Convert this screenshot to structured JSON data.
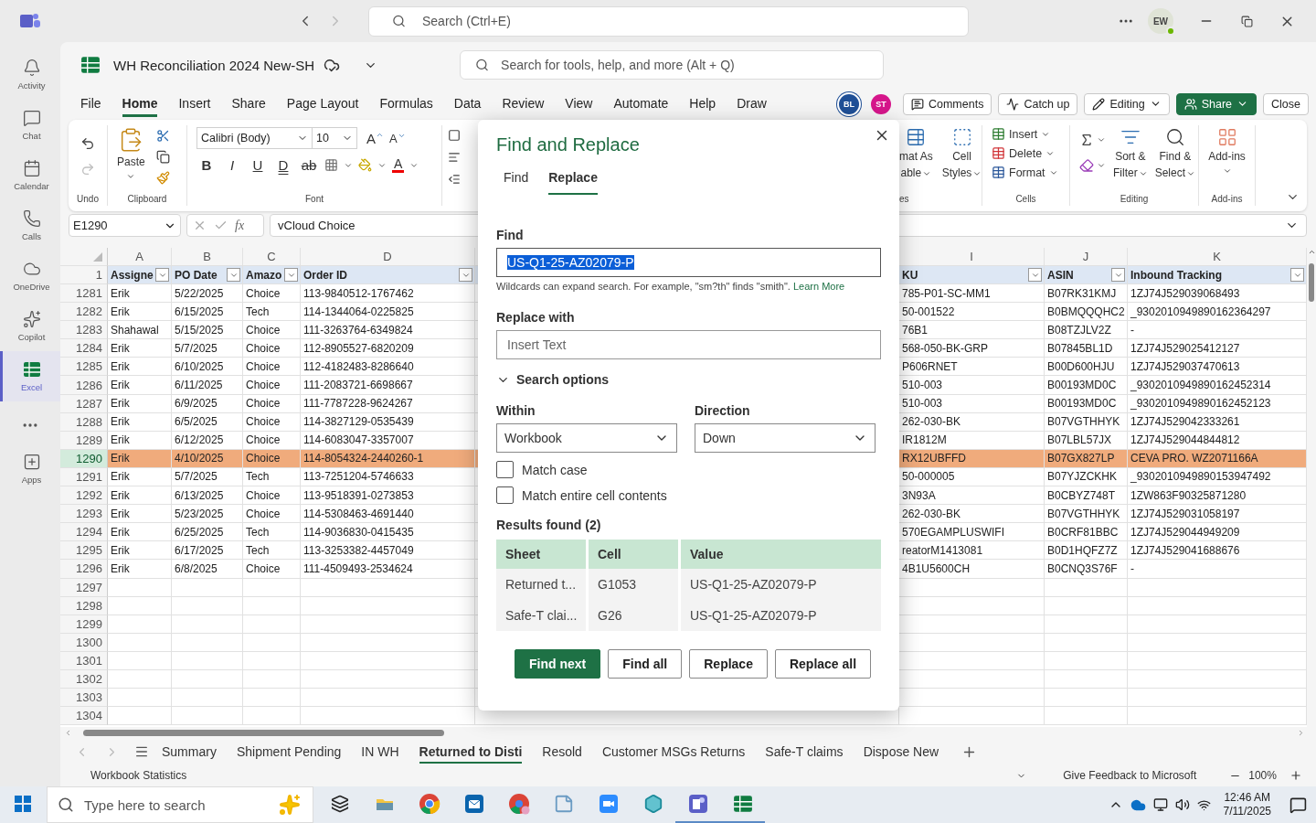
{
  "teams_bar": {
    "search_placeholder": "Search (Ctrl+E)",
    "avatar": "EW"
  },
  "rail": {
    "items": [
      {
        "label": "Activity",
        "selected": false
      },
      {
        "label": "Chat",
        "selected": false
      },
      {
        "label": "Calendar",
        "selected": false
      },
      {
        "label": "Calls",
        "selected": false
      },
      {
        "label": "OneDrive",
        "selected": false
      },
      {
        "label": "Copilot",
        "selected": false
      },
      {
        "label": "Excel",
        "selected": true
      }
    ],
    "apps_label": "Apps"
  },
  "workbook": {
    "title": "WH Reconciliation 2024 New-SH",
    "search_placeholder": "Search for tools, help, and more (Alt + Q)"
  },
  "menu_tabs": [
    {
      "label": "File",
      "selected": false
    },
    {
      "label": "Home",
      "selected": true
    },
    {
      "label": "Insert",
      "selected": false
    },
    {
      "label": "Share",
      "selected": false
    },
    {
      "label": "Page Layout",
      "selected": false
    },
    {
      "label": "Formulas",
      "selected": false
    },
    {
      "label": "Data",
      "selected": false
    },
    {
      "label": "Review",
      "selected": false
    },
    {
      "label": "View",
      "selected": false
    },
    {
      "label": "Automate",
      "selected": false
    },
    {
      "label": "Help",
      "selected": false
    },
    {
      "label": "Draw",
      "selected": false
    }
  ],
  "collaborators": [
    {
      "initials": "BL",
      "color": "#1f4f96"
    },
    {
      "initials": "ST",
      "color": "#d6168b"
    }
  ],
  "actions": [
    {
      "label": "Comments",
      "kind": "plain",
      "caret": false
    },
    {
      "label": "Catch up",
      "kind": "plain",
      "caret": false
    },
    {
      "label": "Editing",
      "kind": "plain",
      "caret": true
    },
    {
      "label": "Share",
      "kind": "primary",
      "caret": true
    },
    {
      "label": "Close",
      "kind": "plain",
      "caret": false
    }
  ],
  "ribbon": {
    "undo": {
      "label": "Undo",
      "redo_disabled": true
    },
    "clipboard": {
      "label": "Clipboard",
      "paste": "Paste"
    },
    "font": {
      "label": "Font",
      "face": "Calibri (Body)",
      "size": "10",
      "grow": "A",
      "shrink": "A",
      "font_color": "A",
      "styles": [
        {
          "label": "B",
          "kind": "bold"
        },
        {
          "label": "I",
          "kind": "italic"
        },
        {
          "label": "U",
          "kind": "underline"
        },
        {
          "label": "D",
          "kind": "double"
        },
        {
          "label": "ab",
          "kind": "strike"
        }
      ]
    },
    "styles_group": {
      "label": "es",
      "format_table": [
        "mat As",
        "able"
      ],
      "cell_styles": [
        "Cell",
        "Styles"
      ]
    },
    "cells": {
      "label": "Cells",
      "items": [
        "Insert",
        "Delete",
        "Format"
      ]
    },
    "editing": {
      "label": "Editing",
      "sort": [
        "Sort &",
        "Filter"
      ],
      "find": [
        "Find &",
        "Select"
      ]
    },
    "addins": {
      "label": "Add-ins",
      "button": "Add-ins"
    }
  },
  "formula_bar": {
    "name_box": "E1290",
    "fx": "fx",
    "value": "vCloud Choice"
  },
  "grid": {
    "header_row_number": "1",
    "columns": [
      {
        "letter": "A",
        "header": "Assigne"
      },
      {
        "letter": "B",
        "header": "PO Date"
      },
      {
        "letter": "C",
        "header": "Amazo"
      },
      {
        "letter": "D",
        "header": "Order ID"
      },
      {
        "letter": "I",
        "header": "KU"
      },
      {
        "letter": "J",
        "header": "ASIN"
      },
      {
        "letter": "K",
        "header": "Inbound Tracking"
      }
    ],
    "rows": [
      {
        "number": "1281",
        "selected": false,
        "cells": [
          "Erik",
          "5/22/2025",
          "Choice",
          "113-9840512-1767462",
          "785-P01-SC-MM1",
          "B07RK31KMJ",
          "1ZJ74J529039068493"
        ]
      },
      {
        "number": "1282",
        "selected": false,
        "cells": [
          "Erik",
          "6/15/2025",
          "Tech",
          "114-1344064-0225825",
          "50-001522",
          "B0BMQQQHC2",
          "_9302010949890162364297"
        ]
      },
      {
        "number": "1283",
        "selected": false,
        "cells": [
          "Shahawal",
          "5/15/2025",
          "Choice",
          "111-3263764-6349824",
          "76B1",
          "B08TZJLV2Z",
          "-"
        ]
      },
      {
        "number": "1284",
        "selected": false,
        "cells": [
          "Erik",
          "5/7/2025",
          "Choice",
          "112-8905527-6820209",
          "568-050-BK-GRP",
          "B07845BL1D",
          "1ZJ74J529025412127"
        ]
      },
      {
        "number": "1285",
        "selected": false,
        "cells": [
          "Erik",
          "6/10/2025",
          "Choice",
          "112-4182483-8286640",
          "P606RNET",
          "B00D600HJU",
          "1ZJ74J529037470613"
        ]
      },
      {
        "number": "1286",
        "selected": false,
        "cells": [
          "Erik",
          "6/11/2025",
          "Choice",
          "111-2083721-6698667",
          "510-003",
          "B00193MD0C",
          "_9302010949890162452314"
        ]
      },
      {
        "number": "1287",
        "selected": false,
        "cells": [
          "Erik",
          "6/9/2025",
          "Choice",
          "111-7787228-9624267",
          "510-003",
          "B00193MD0C",
          "_9302010949890162452123"
        ]
      },
      {
        "number": "1288",
        "selected": false,
        "cells": [
          "Erik",
          "6/5/2025",
          "Choice",
          "114-3827129-0535439",
          "262-030-BK",
          "B07VGTHHYK",
          "1ZJ74J529042333261"
        ]
      },
      {
        "number": "1289",
        "selected": false,
        "cells": [
          "Erik",
          "6/12/2025",
          "Choice",
          "114-6083047-3357007",
          "IR1812M",
          "B07LBL57JX",
          "1ZJ74J529044844812"
        ]
      },
      {
        "number": "1290",
        "selected": true,
        "cells": [
          "Erik",
          "4/10/2025",
          "Choice",
          "114-8054324-2440260-1",
          "RX12UBFFD",
          "B07GX827LP",
          "CEVA PRO. WZ2071166A"
        ]
      },
      {
        "number": "1291",
        "selected": false,
        "cells": [
          "Erik",
          "5/7/2025",
          "Tech",
          "113-7251204-5746633",
          "50-000005",
          "B07YJZCKHK",
          "_9302010949890153947492"
        ]
      },
      {
        "number": "1292",
        "selected": false,
        "cells": [
          "Erik",
          "6/13/2025",
          "Choice",
          "113-9518391-0273853",
          "3N93A",
          "B0CBYZ748T",
          "1ZW863F90325871280"
        ]
      },
      {
        "number": "1293",
        "selected": false,
        "cells": [
          "Erik",
          "5/23/2025",
          "Choice",
          "114-5308463-4691440",
          "262-030-BK",
          "B07VGTHHYK",
          "1ZJ74J529031058197"
        ]
      },
      {
        "number": "1294",
        "selected": false,
        "cells": [
          "Erik",
          "6/25/2025",
          "Tech",
          "114-9036830-0415435",
          "570EGAMPLUSWIFI",
          "B0CRF81BBC",
          "1ZJ74J529044949209"
        ]
      },
      {
        "number": "1295",
        "selected": false,
        "cells": [
          "Erik",
          "6/17/2025",
          "Tech",
          "113-3253382-4457049",
          "reatorM1413081",
          "B0D1HQFZ7Z",
          "1ZJ74J529041688676"
        ]
      },
      {
        "number": "1296",
        "selected": false,
        "cells": [
          "Erik",
          "6/8/2025",
          "Choice",
          "111-4509493-2534624",
          "4B1U5600CH",
          "B0CNQ3S76F",
          "-"
        ]
      },
      {
        "number": "1297",
        "selected": false
      },
      {
        "number": "1298",
        "selected": false
      },
      {
        "number": "1299",
        "selected": false
      },
      {
        "number": "1300",
        "selected": false
      },
      {
        "number": "1301",
        "selected": false
      },
      {
        "number": "1302",
        "selected": false
      },
      {
        "number": "1303",
        "selected": false
      },
      {
        "number": "1304",
        "selected": false
      }
    ]
  },
  "dialog": {
    "title": "Find and Replace",
    "tabs": [
      {
        "label": "Find",
        "selected": false
      },
      {
        "label": "Replace",
        "selected": true
      }
    ],
    "find_label": "Find",
    "find_value": "US-Q1-25-AZ02079-P",
    "find_value_selected": true,
    "hint": "Wildcards can expand search. For example, \"sm?th\" finds \"smith\".",
    "hint_link": "Learn More",
    "replace_label": "Replace with",
    "replace_placeholder": "Insert Text",
    "search_options": {
      "label": "Search options",
      "expanded": true
    },
    "within": {
      "label": "Within",
      "value": "Workbook"
    },
    "direction": {
      "label": "Direction",
      "value": "Down"
    },
    "checkboxes": [
      {
        "label": "Match case",
        "checked": false
      },
      {
        "label": "Match entire cell contents",
        "checked": false
      }
    ],
    "results_label": "Results found (2)",
    "results_columns": [
      "Sheet",
      "Cell",
      "Value"
    ],
    "results": [
      [
        "Returned t...",
        "G1053",
        "US-Q1-25-AZ02079-P"
      ],
      [
        "Safe-T clai...",
        "G26",
        "US-Q1-25-AZ02079-P"
      ]
    ],
    "buttons": [
      {
        "label": "Find next",
        "kind": "primary"
      },
      {
        "label": "Find all",
        "kind": "plain"
      },
      {
        "label": "Replace",
        "kind": "plain"
      },
      {
        "label": "Replace all",
        "kind": "plain"
      }
    ]
  },
  "sheet_tabs": [
    {
      "label": "Summary",
      "selected": false
    },
    {
      "label": "Shipment Pending",
      "selected": false
    },
    {
      "label": "IN WH",
      "selected": false
    },
    {
      "label": "Returned to Disti",
      "selected": true
    },
    {
      "label": "Resold",
      "selected": false
    },
    {
      "label": "Customer MSGs Returns",
      "selected": false
    },
    {
      "label": "Safe-T claims",
      "selected": false
    },
    {
      "label": "Dispose New",
      "selected": false
    }
  ],
  "status_bar": {
    "statistics": "Workbook Statistics",
    "feedback": "Give Feedback to Microsoft",
    "zoom": "100%"
  },
  "taskbar": {
    "search_placeholder": "Type here to search",
    "time": "12:46 AM",
    "date": "7/11/2025"
  }
}
